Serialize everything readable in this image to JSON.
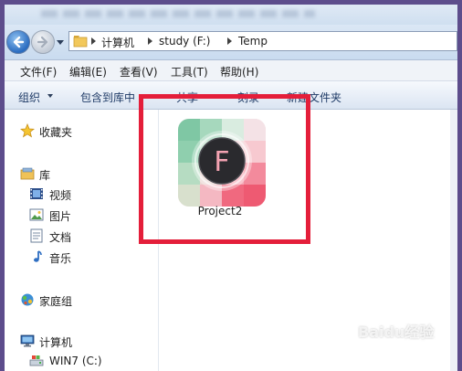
{
  "address": {
    "crumbs": [
      "计算机",
      "study (F:)",
      "Temp"
    ]
  },
  "menu": [
    "文件(F)",
    "编辑(E)",
    "查看(V)",
    "工具(T)",
    "帮助(H)"
  ],
  "toolbar": {
    "organize": "组织",
    "include_in_library": "包含到库中",
    "share": "共享",
    "burn": "刻录",
    "new_folder": "新建文件夹"
  },
  "sidebar": {
    "favorites": "收藏夹",
    "libraries": "库",
    "lib_items": [
      "视频",
      "图片",
      "文档",
      "音乐"
    ],
    "homegroup": "家庭组",
    "computer": "计算机",
    "drive": "WIN7 (C:)"
  },
  "files": [
    {
      "name": "Project2",
      "icon": "project-app-icon",
      "glyph": "F"
    }
  ],
  "colors": {
    "highlight": "#e41e3a",
    "background": "#5d4d8c"
  },
  "watermark": "Baidu经验"
}
